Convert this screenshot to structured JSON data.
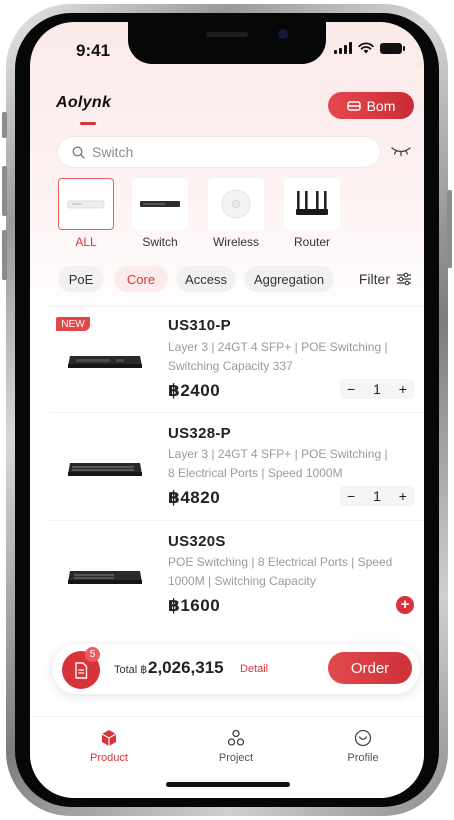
{
  "status": {
    "time": "9:41"
  },
  "header": {
    "logo": "Aolynk",
    "bom_label": "Bom"
  },
  "search": {
    "placeholder": "Switch"
  },
  "categories": [
    {
      "label": "ALL",
      "active": true
    },
    {
      "label": "Switch",
      "active": false
    },
    {
      "label": "Wireless",
      "active": false
    },
    {
      "label": "Router",
      "active": false
    }
  ],
  "filters": {
    "chips": [
      {
        "label": "PoE",
        "active": false
      },
      {
        "label": "Core",
        "active": true
      },
      {
        "label": "Access",
        "active": false
      },
      {
        "label": "Aggregation",
        "active": false
      }
    ],
    "filter_label": "Filter"
  },
  "products": [
    {
      "badge": "NEW",
      "title": "US310-P",
      "desc_line1": "Layer 3 | 24GT 4 SFP+ | POE Switching |",
      "desc_line2": "Switching Capacity 337",
      "price": "฿2400",
      "quantity": "1",
      "minus": "−",
      "plus": "+"
    },
    {
      "title": "US328-P",
      "desc_line1": "Layer 3 | 24GT 4 SFP+ |  POE Switching |",
      "desc_line2": "8 Electrical Ports | Speed 1000M",
      "price": "฿4820",
      "quantity": "1",
      "minus": "−",
      "plus": "+"
    },
    {
      "title": "US320S",
      "desc_line1": "POE Switching | 8 Electrical Ports | Speed",
      "desc_line2": "1000M | Switching Capacity",
      "price": "฿1600",
      "add": "+"
    }
  ],
  "order": {
    "cart_count": "5",
    "total_label": "Total ฿",
    "total_value": "2,026,315",
    "detail_label": "Detail",
    "order_label": "Order"
  },
  "tabs": [
    {
      "label": "Product",
      "active": true,
      "icon": "cube-icon"
    },
    {
      "label": "Project",
      "active": false,
      "icon": "network-icon"
    },
    {
      "label": "Profile",
      "active": false,
      "icon": "profile-icon"
    }
  ],
  "colors": {
    "accent": "#d9333a",
    "accent_light": "#fdeaea",
    "text": "#222222",
    "muted": "#9a9a9a"
  }
}
